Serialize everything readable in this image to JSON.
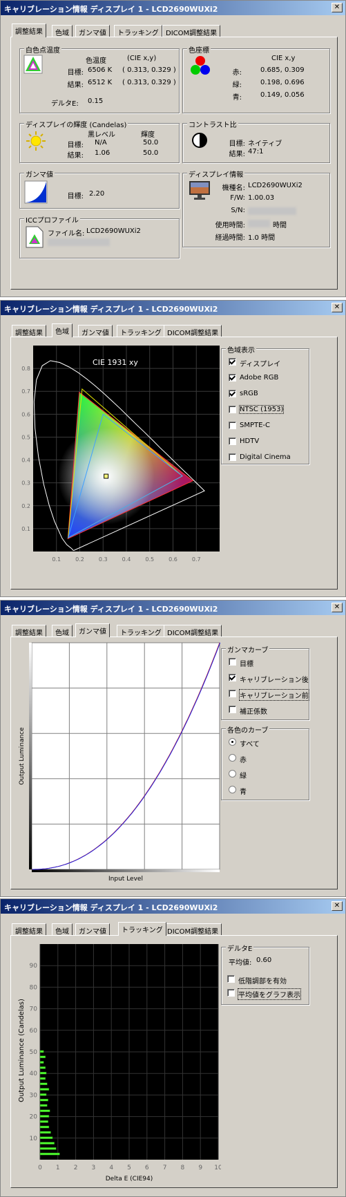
{
  "windows": [
    {
      "title": "キャリブレーション情報 ディスプレイ 1 - LCD2690WUXi2"
    },
    {
      "title": "キャリブレーション情報 ディスプレイ 1 - LCD2690WUXi2"
    },
    {
      "title": "キャリブレーション情報 ディスプレイ 1 - LCD2690WUXi2"
    },
    {
      "title": "キャリブレーション情報 ディスプレイ 1 - LCD2690WUXi2"
    }
  ],
  "close_label": "✕",
  "tabs": [
    "調整結果",
    "色域",
    "ガンマ値",
    "トラッキング",
    "DICOM調整結果"
  ],
  "summary": {
    "white_point": {
      "title": "白色点温度",
      "col_temp": "色温度",
      "col_cie": "(CIE x,y)",
      "target_label": "目標:",
      "target_temp": "6506 K",
      "target_xy": "( 0.313, 0.329 )",
      "result_label": "結果:",
      "result_temp": "6512 K",
      "result_xy": "( 0.313, 0.329 )",
      "delta_label": "デルタE:",
      "delta_value": "0.15"
    },
    "primaries": {
      "title": "色座標",
      "col_cie": "CIE x,y",
      "rows": [
        {
          "label": "赤:",
          "value": "0.685, 0.309"
        },
        {
          "label": "緑:",
          "value": "0.198, 0.696"
        },
        {
          "label": "青:",
          "value": "0.149, 0.056"
        }
      ]
    },
    "luminance": {
      "title": "ディスプレイの輝度 (Candelas)",
      "col_black": "黒レベル",
      "col_lum": "輝度",
      "target_label": "目標:",
      "target_black": "N/A",
      "target_lum": "50.0",
      "result_label": "結果:",
      "result_black": "1.06",
      "result_lum": "50.0"
    },
    "contrast": {
      "title": "コントラスト比",
      "target_label": "目標:",
      "target_value": "ネイティブ",
      "result_label": "結果:",
      "result_value": "47:1"
    },
    "gamma": {
      "title": "ガンマ値",
      "target_label": "目標:",
      "target_value": "2.20"
    },
    "display_info": {
      "title": "ディスプレイ情報",
      "model_label": "機種名:",
      "model_value": "LCD2690WUXi2",
      "fw_label": "F/W:",
      "fw_value": "1.00.03",
      "sn_label": "S/N:",
      "usage_label": "使用時間:",
      "usage_suffix": "時間",
      "elapsed_label": "経過時間:",
      "elapsed_value": "1.0 時間"
    },
    "icc": {
      "title": "ICCプロファイル",
      "file_label": "ファイル名:",
      "file_value": "LCD2690WUXi2"
    }
  },
  "gamut": {
    "chart_title": "CIE 1931 xy",
    "group_title": "色域表示",
    "options": [
      {
        "label": "ディスプレイ",
        "checked": true
      },
      {
        "label": "Adobe RGB",
        "checked": true
      },
      {
        "label": "sRGB",
        "checked": true
      },
      {
        "label": "NTSC (1953)",
        "checked": false
      },
      {
        "label": "SMPTE-C",
        "checked": false
      },
      {
        "label": "HDTV",
        "checked": false
      },
      {
        "label": "Digital Cinema",
        "checked": false
      }
    ],
    "chart_data": {
      "type": "scatter",
      "title": "CIE 1931 xy",
      "xlim": [
        0.0,
        0.8
      ],
      "ylim": [
        0.0,
        0.9
      ],
      "x_ticks": [
        0.1,
        0.2,
        0.3,
        0.4,
        0.5,
        0.6,
        0.7
      ],
      "y_ticks": [
        0.1,
        0.2,
        0.3,
        0.4,
        0.5,
        0.6,
        0.7,
        0.8
      ],
      "display_gamut": [
        [
          0.685,
          0.309
        ],
        [
          0.198,
          0.696
        ],
        [
          0.149,
          0.056
        ]
      ],
      "adobe_rgb": [
        [
          0.64,
          0.33
        ],
        [
          0.21,
          0.71
        ],
        [
          0.15,
          0.06
        ]
      ],
      "srgb": [
        [
          0.64,
          0.33
        ],
        [
          0.3,
          0.6
        ],
        [
          0.15,
          0.06
        ]
      ],
      "white_point": [
        0.313,
        0.329
      ]
    }
  },
  "gamma_tab": {
    "group_curve": "ガンマカーブ",
    "curve_options": [
      {
        "label": "目標",
        "checked": false
      },
      {
        "label": "キャリブレーション後",
        "checked": true
      },
      {
        "label": "キャリブレーション前",
        "checked": false
      },
      {
        "label": "補正係数",
        "checked": false
      }
    ],
    "group_color": "各色のカーブ",
    "color_options": [
      {
        "label": "すべて",
        "checked": true
      },
      {
        "label": "赤",
        "checked": false
      },
      {
        "label": "緑",
        "checked": false
      },
      {
        "label": "青",
        "checked": false
      }
    ],
    "ylabel": "Output Luminance",
    "xlabel": "Input Level",
    "chart_data": {
      "type": "line",
      "gamma": 2.2,
      "xlim": [
        0,
        1
      ],
      "ylim": [
        0,
        1
      ],
      "series": [
        {
          "values": "y = x^2.2"
        }
      ]
    }
  },
  "tracking_tab": {
    "group_title": "デルタE",
    "avg_label": "平均値:",
    "avg_value": "0.60",
    "options": [
      {
        "label": "低階調部を有効",
        "checked": false
      },
      {
        "label": "平均値をグラフ表示",
        "checked": false
      }
    ],
    "ylabel": "Output Luminance (Candelas)",
    "xlabel": "Delta E (CIE94)",
    "chart_data": {
      "type": "bar",
      "orientation": "horizontal",
      "xlim": [
        0,
        10
      ],
      "ylim": [
        0,
        100
      ],
      "x_ticks": [
        0,
        1,
        2,
        3,
        4,
        5,
        6,
        7,
        8,
        9,
        10
      ],
      "y_ticks": [
        10,
        20,
        30,
        40,
        50,
        60,
        70,
        80,
        90
      ],
      "luminance": [
        2.5,
        5,
        7.5,
        10,
        12.5,
        15,
        17.5,
        20,
        22.5,
        25,
        27.5,
        30,
        32.5,
        35,
        37.5,
        40,
        42.5,
        45,
        47.5,
        50
      ],
      "delta_e": [
        1.1,
        0.9,
        0.8,
        0.7,
        0.6,
        0.5,
        0.45,
        0.5,
        0.55,
        0.4,
        0.45,
        0.35,
        0.5,
        0.4,
        0.3,
        0.35,
        0.3,
        0.2,
        0.3,
        0.2
      ]
    }
  }
}
